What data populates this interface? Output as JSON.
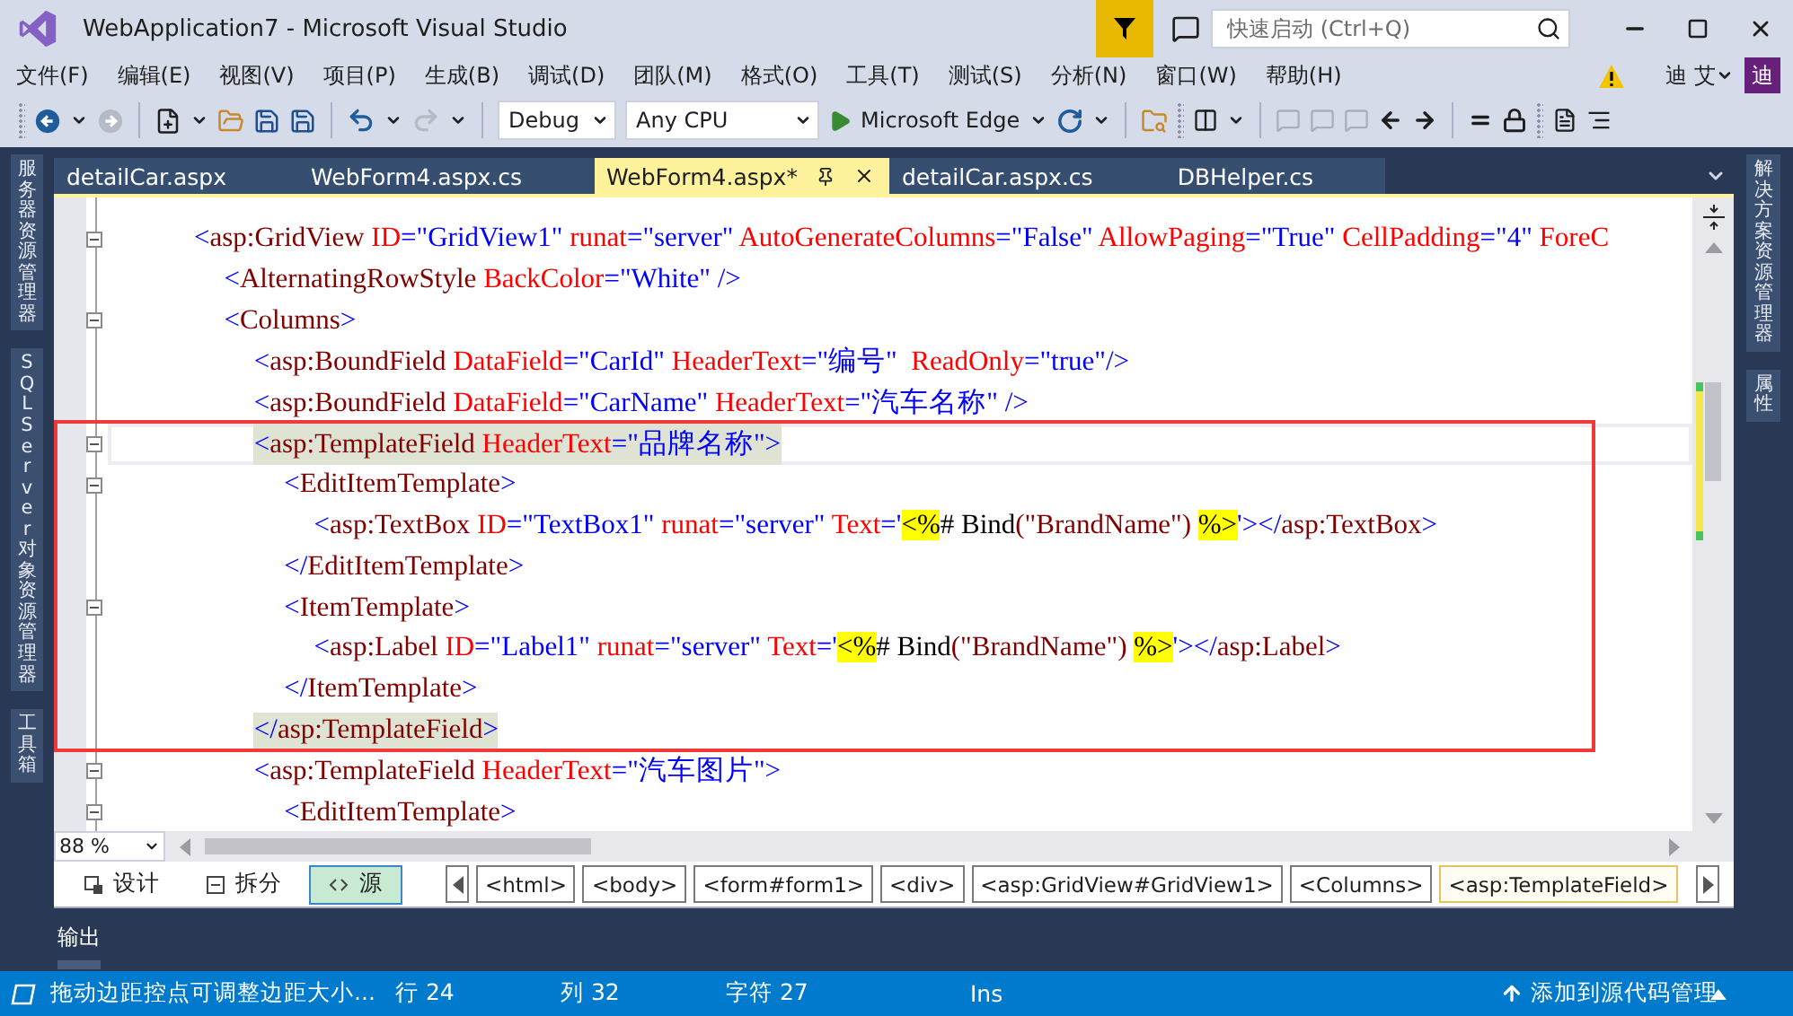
{
  "window": {
    "title": "WebApplication7 - Microsoft Visual Studio"
  },
  "quick_launch": {
    "placeholder": "快速启动 (Ctrl+Q)"
  },
  "menu": [
    "文件(F)",
    "编辑(E)",
    "视图(V)",
    "项目(P)",
    "生成(B)",
    "调试(D)",
    "团队(M)",
    "格式(O)",
    "工具(T)",
    "测试(S)",
    "分析(N)",
    "窗口(W)",
    "帮助(H)"
  ],
  "account": {
    "user": "迪 艾",
    "avatar": "迪"
  },
  "toolbar": {
    "back_disabled": false,
    "forward_disabled": true,
    "redo_disabled": true,
    "bookmarks_disabled": true,
    "configuration": "Debug",
    "platform": "Any CPU",
    "run_target": "Microsoft Edge"
  },
  "left_tool_tabs": [
    "服务器资源管理器",
    "SQL Server 对象资源管理器",
    "工具箱"
  ],
  "right_tool_tabs": [
    "解决方案资源管理器",
    "属性"
  ],
  "document_tabs": [
    {
      "label": "detailCar.aspx",
      "selected": false
    },
    {
      "label": "WebForm4.aspx.cs",
      "selected": false
    },
    {
      "label": "WebForm4.aspx*",
      "selected": true
    },
    {
      "label": "detailCar.aspx.cs",
      "selected": false
    },
    {
      "label": "DBHelper.cs",
      "selected": false
    }
  ],
  "code_lines": [
    {
      "foldable": true,
      "current": false,
      "matched": false,
      "tokens": [
        {
          "kind": "delim",
          "text": "<"
        },
        {
          "kind": "tag",
          "text": "asp:GridView"
        },
        {
          "kind": "attr",
          "text": " ID"
        },
        {
          "kind": "value",
          "text": "=\"GridView1\""
        },
        {
          "kind": "attr",
          "text": " runat"
        },
        {
          "kind": "value",
          "text": "=\"server\""
        },
        {
          "kind": "attr",
          "text": " AutoGenerateColumns"
        },
        {
          "kind": "value",
          "text": "=\"False\""
        },
        {
          "kind": "attr",
          "text": " AllowPaging"
        },
        {
          "kind": "value",
          "text": "=\"True\""
        },
        {
          "kind": "attr",
          "text": " CellPadding"
        },
        {
          "kind": "value",
          "text": "=\"4\""
        },
        {
          "kind": "attr",
          "text": " ForeC"
        }
      ],
      "children": [
        {
          "foldable": false,
          "current": false,
          "matched": false,
          "tokens": [
            {
              "kind": "delim",
              "text": "<"
            },
            {
              "kind": "tag",
              "text": "AlternatingRowStyle"
            },
            {
              "kind": "attr",
              "text": " BackColor"
            },
            {
              "kind": "value",
              "text": "=\"White\""
            },
            {
              "kind": "delim",
              "text": " />"
            }
          ]
        },
        {
          "foldable": true,
          "current": false,
          "matched": false,
          "tokens": [
            {
              "kind": "delim",
              "text": "<"
            },
            {
              "kind": "tag",
              "text": "Columns"
            },
            {
              "kind": "delim",
              "text": ">"
            }
          ],
          "children": [
            {
              "foldable": false,
              "current": false,
              "matched": false,
              "tokens": [
                {
                  "kind": "delim",
                  "text": "<"
                },
                {
                  "kind": "tag",
                  "text": "asp:BoundField"
                },
                {
                  "kind": "attr",
                  "text": " DataField"
                },
                {
                  "kind": "value",
                  "text": "=\"CarId\""
                },
                {
                  "kind": "attr",
                  "text": " HeaderText"
                },
                {
                  "kind": "value",
                  "text": "=\"编号\""
                },
                {
                  "kind": "attr",
                  "text": "  ReadOnly"
                },
                {
                  "kind": "value",
                  "text": "=\"true\""
                },
                {
                  "kind": "delim",
                  "text": "/>"
                }
              ]
            },
            {
              "foldable": false,
              "current": false,
              "matched": false,
              "tokens": [
                {
                  "kind": "delim",
                  "text": "<"
                },
                {
                  "kind": "tag",
                  "text": "asp:BoundField"
                },
                {
                  "kind": "attr",
                  "text": " DataField"
                },
                {
                  "kind": "value",
                  "text": "=\"CarName\""
                },
                {
                  "kind": "attr",
                  "text": " HeaderText"
                },
                {
                  "kind": "value",
                  "text": "=\"汽车名称\""
                },
                {
                  "kind": "delim",
                  "text": " />"
                }
              ]
            },
            {
              "foldable": true,
              "current": true,
              "matched": true,
              "tokens": [
                {
                  "kind": "delim",
                  "text": "<"
                },
                {
                  "kind": "tag",
                  "text": "asp:TemplateField"
                },
                {
                  "kind": "attr",
                  "text": " HeaderText"
                },
                {
                  "kind": "value",
                  "text": "=\"品牌名称\""
                },
                {
                  "kind": "delim",
                  "text": ">"
                }
              ],
              "children": [
                {
                  "foldable": true,
                  "current": false,
                  "matched": false,
                  "tokens": [
                    {
                      "kind": "delim",
                      "text": "<"
                    },
                    {
                      "kind": "tag",
                      "text": "EditItemTemplate"
                    },
                    {
                      "kind": "delim",
                      "text": ">"
                    }
                  ],
                  "children": [
                    {
                      "foldable": false,
                      "current": false,
                      "matched": false,
                      "tokens": [
                        {
                          "kind": "delim",
                          "text": "<"
                        },
                        {
                          "kind": "tag",
                          "text": "asp:TextBox"
                        },
                        {
                          "kind": "attr",
                          "text": " ID"
                        },
                        {
                          "kind": "value",
                          "text": "=\"TextBox1\""
                        },
                        {
                          "kind": "attr",
                          "text": " runat"
                        },
                        {
                          "kind": "value",
                          "text": "=\"server\""
                        },
                        {
                          "kind": "attr",
                          "text": " Text"
                        },
                        {
                          "kind": "value",
                          "text": "='"
                        },
                        {
                          "kind": "marker",
                          "text": "<%"
                        },
                        {
                          "kind": "plain",
                          "text": "# Bind"
                        },
                        {
                          "kind": "tag",
                          "text": "(\"BrandName\") "
                        },
                        {
                          "kind": "marker",
                          "text": "%>"
                        },
                        {
                          "kind": "value",
                          "text": "'>"
                        },
                        {
                          "kind": "delim",
                          "text": "</"
                        },
                        {
                          "kind": "tag",
                          "text": "asp:TextBox"
                        },
                        {
                          "kind": "delim",
                          "text": ">"
                        }
                      ]
                    }
                  ]
                },
                {
                  "foldable": false,
                  "current": false,
                  "matched": false,
                  "tokens": [
                    {
                      "kind": "delim",
                      "text": "</"
                    },
                    {
                      "kind": "tag",
                      "text": "EditItemTemplate"
                    },
                    {
                      "kind": "delim",
                      "text": ">"
                    }
                  ]
                },
                {
                  "foldable": true,
                  "current": false,
                  "matched": false,
                  "tokens": [
                    {
                      "kind": "delim",
                      "text": "<"
                    },
                    {
                      "kind": "tag",
                      "text": "ItemTemplate"
                    },
                    {
                      "kind": "delim",
                      "text": ">"
                    }
                  ],
                  "children": [
                    {
                      "foldable": false,
                      "current": false,
                      "matched": false,
                      "tokens": [
                        {
                          "kind": "delim",
                          "text": "<"
                        },
                        {
                          "kind": "tag",
                          "text": "asp:Label"
                        },
                        {
                          "kind": "attr",
                          "text": " ID"
                        },
                        {
                          "kind": "value",
                          "text": "=\"Label1\""
                        },
                        {
                          "kind": "attr",
                          "text": " runat"
                        },
                        {
                          "kind": "value",
                          "text": "=\"server\""
                        },
                        {
                          "kind": "attr",
                          "text": " Text"
                        },
                        {
                          "kind": "value",
                          "text": "='"
                        },
                        {
                          "kind": "marker",
                          "text": "<%"
                        },
                        {
                          "kind": "plain",
                          "text": "# Bind"
                        },
                        {
                          "kind": "tag",
                          "text": "(\"BrandName\") "
                        },
                        {
                          "kind": "marker",
                          "text": "%>"
                        },
                        {
                          "kind": "value",
                          "text": "'>"
                        },
                        {
                          "kind": "delim",
                          "text": "</"
                        },
                        {
                          "kind": "tag",
                          "text": "asp:Label"
                        },
                        {
                          "kind": "delim",
                          "text": ">"
                        }
                      ]
                    }
                  ]
                },
                {
                  "foldable": false,
                  "current": false,
                  "matched": false,
                  "tokens": [
                    {
                      "kind": "delim",
                      "text": "</"
                    },
                    {
                      "kind": "tag",
                      "text": "ItemTemplate"
                    },
                    {
                      "kind": "delim",
                      "text": ">"
                    }
                  ]
                }
              ]
            },
            {
              "foldable": false,
              "current": false,
              "matched": true,
              "tokens": [
                {
                  "kind": "delim",
                  "text": "</"
                },
                {
                  "kind": "tag",
                  "text": "asp:TemplateField"
                },
                {
                  "kind": "delim",
                  "text": ">"
                }
              ]
            },
            {
              "foldable": true,
              "current": false,
              "matched": false,
              "tokens": [
                {
                  "kind": "delim",
                  "text": "<"
                },
                {
                  "kind": "tag",
                  "text": "asp:TemplateField"
                },
                {
                  "kind": "attr",
                  "text": " HeaderText"
                },
                {
                  "kind": "value",
                  "text": "=\"汽车图片\""
                },
                {
                  "kind": "delim",
                  "text": ">"
                }
              ],
              "children": [
                {
                  "foldable": true,
                  "current": false,
                  "matched": false,
                  "tokens": [
                    {
                      "kind": "delim",
                      "text": "<"
                    },
                    {
                      "kind": "tag",
                      "text": "EditItemTemplate"
                    },
                    {
                      "kind": "delim",
                      "text": ">"
                    }
                  ]
                }
              ]
            }
          ]
        }
      ]
    }
  ],
  "zoom": "88 %",
  "view_modes": [
    {
      "label": "设计",
      "selected": false
    },
    {
      "label": "拆分",
      "selected": false
    },
    {
      "label": "源",
      "selected": true
    }
  ],
  "breadcrumbs": [
    {
      "label": "<html>",
      "selected": false
    },
    {
      "label": "<body>",
      "selected": false
    },
    {
      "label": "<form#form1>",
      "selected": false
    },
    {
      "label": "<div>",
      "selected": false
    },
    {
      "label": "<asp:GridView#GridView1>",
      "selected": false
    },
    {
      "label": "<Columns>",
      "selected": false
    },
    {
      "label": "<asp:TemplateField>",
      "selected": true
    }
  ],
  "output_tab": "输出",
  "status_bar": {
    "message": "拖动边距控点可调整边距大小...",
    "line": "行 24",
    "column": "列 32",
    "char": "字符 27",
    "mode": "Ins",
    "source_control": "添加到源代码管理"
  }
}
